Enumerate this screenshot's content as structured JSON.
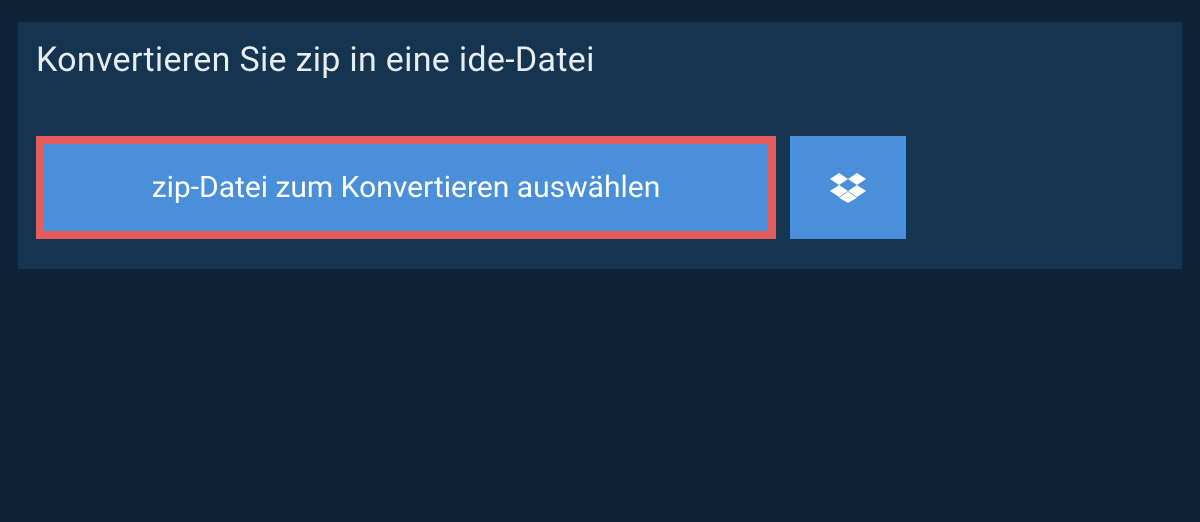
{
  "header": {
    "title": "Konvertieren Sie zip in eine ide-Datei"
  },
  "actions": {
    "select_file_label": "zip-Datei zum Konvertieren auswählen"
  },
  "colors": {
    "page_bg": "#0d2438",
    "panel_bg": "#14344f",
    "button_bg": "#4a8fd9",
    "highlight_border": "#e45c5c",
    "text_light": "#ffffff"
  }
}
